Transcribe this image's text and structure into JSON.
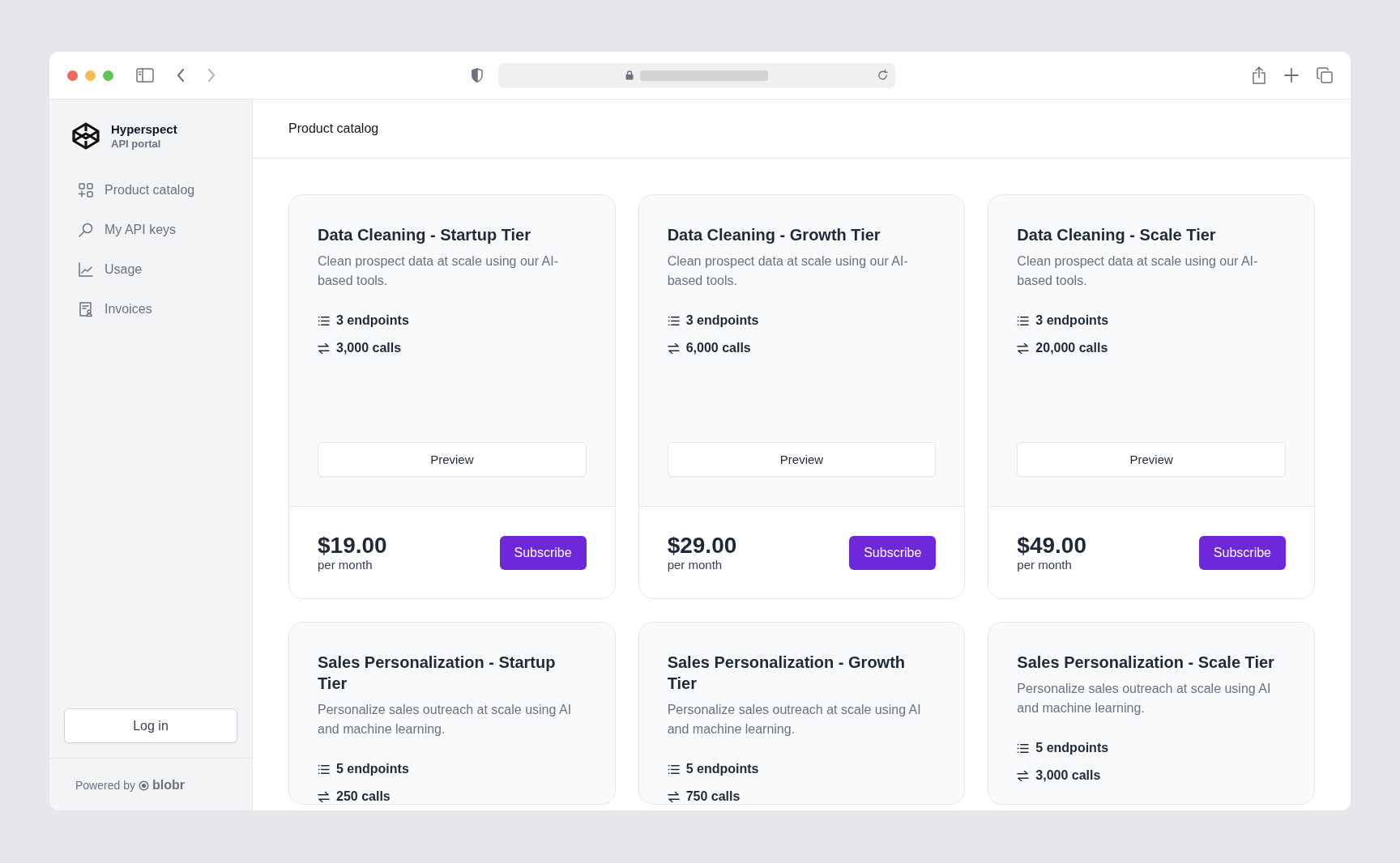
{
  "brand": {
    "name": "Hyperspect",
    "subtitle": "API portal"
  },
  "nav": [
    {
      "kind": "catalog",
      "label": "Product catalog"
    },
    {
      "kind": "keys",
      "label": "My API keys"
    },
    {
      "kind": "usage",
      "label": "Usage"
    },
    {
      "kind": "invoices",
      "label": "Invoices"
    }
  ],
  "login_button": "Log in",
  "footer": {
    "prefix": "Powered by",
    "brand": "blobr"
  },
  "page_title": "Product catalog",
  "products": [
    {
      "title": "Data Cleaning - Startup Tier",
      "description": "Clean prospect data at scale using our AI-based tools.",
      "endpoints": "3 endpoints",
      "calls": "3,000 calls",
      "preview": "Preview",
      "price": "$19.00",
      "period": "per month",
      "subscribe": "Subscribe"
    },
    {
      "title": "Data Cleaning - Growth Tier",
      "description": "Clean prospect data at scale using our AI-based tools.",
      "endpoints": "3 endpoints",
      "calls": "6,000 calls",
      "preview": "Preview",
      "price": "$29.00",
      "period": "per month",
      "subscribe": "Subscribe"
    },
    {
      "title": "Data Cleaning - Scale Tier",
      "description": "Clean prospect data at scale using our AI-based tools.",
      "endpoints": "3 endpoints",
      "calls": "20,000 calls",
      "preview": "Preview",
      "price": "$49.00",
      "period": "per month",
      "subscribe": "Subscribe"
    },
    {
      "title": "Sales Personalization - Startup Tier",
      "description": "Personalize sales outreach at scale using AI and machine learning.",
      "endpoints": "5 endpoints",
      "calls": "250 calls"
    },
    {
      "title": "Sales Personalization - Growth Tier",
      "description": "Personalize sales outreach at scale using AI and machine learning.",
      "endpoints": "5 endpoints",
      "calls": "750 calls"
    },
    {
      "title": "Sales Personalization - Scale Tier",
      "description": "Personalize sales outreach at scale using AI and machine learning.",
      "endpoints": "5 endpoints",
      "calls": "3,000 calls"
    }
  ]
}
